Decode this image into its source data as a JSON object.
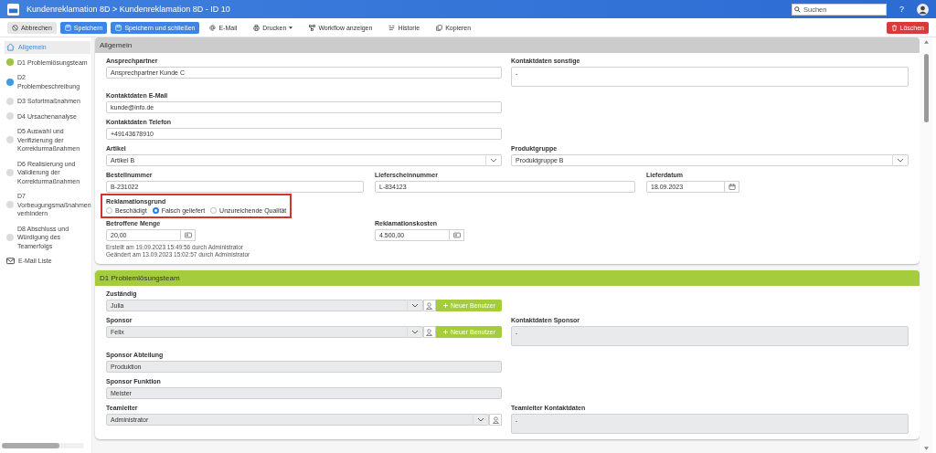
{
  "header": {
    "title": "Kundenreklamation 8D > Kundenreklamation 8D - ID 10",
    "search": {
      "placeholder": "Suchen"
    },
    "help": "?"
  },
  "toolbar": [
    {
      "label": "Abbrechen",
      "kind": "cancel"
    },
    {
      "label": "Speichern",
      "kind": "save"
    },
    {
      "label": "Speichern und schließen",
      "kind": "save"
    },
    {
      "label": "E-Mail",
      "kind": "email"
    },
    {
      "label": "Drucken",
      "kind": "print"
    },
    {
      "label": "Workflow anzeigen",
      "kind": "workflow"
    },
    {
      "label": "Historie",
      "kind": "history"
    },
    {
      "label": "Kopieren",
      "kind": "copy"
    },
    {
      "label": "Löschen",
      "kind": "delete"
    }
  ],
  "sidebar": {
    "items": [
      {
        "label": "Allgemein",
        "kind": "home",
        "selected": true
      },
      {
        "label": "D1 Problemlösungsteam",
        "kind": "step",
        "color": "#9bc53d",
        "selected": false
      },
      {
        "label": "D2 Problembeschreibung",
        "kind": "step",
        "color": "#3d9be9",
        "selected": false
      },
      {
        "label": "D3 Sofortmaßnahmen",
        "kind": "step",
        "color": "#dcdcdc",
        "selected": false
      },
      {
        "label": "D4 Ursachenanalyse",
        "kind": "step",
        "color": "#dcdcdc",
        "selected": false
      },
      {
        "label": "D5 Auswahl und Verifizierung der Korrekturmaßnahmen",
        "kind": "step",
        "color": "#dcdcdc",
        "selected": false
      },
      {
        "label": "D6 Realisierung und Validierung der Korrekturmaßnahmen",
        "kind": "step",
        "color": "#dcdcdc",
        "selected": false
      },
      {
        "label": "D7 Vorbeugungsmaßnahmen verhindern",
        "kind": "step",
        "color": "#dcdcdc",
        "selected": false
      },
      {
        "label": "D8 Abschluss und Würdigung des Teamerfolgs",
        "kind": "step",
        "color": "#dcdcdc",
        "selected": false
      },
      {
        "label": "E-Mail Liste",
        "kind": "mail",
        "selected": false
      }
    ]
  },
  "sections": [
    {
      "title": "Allgemein",
      "color": "#cccccc",
      "rows": [
        {
          "kind": "pair",
          "fields": [
            {
              "label": "Ansprechpartner",
              "kind": "text",
              "value": "Ansprechpartner Kunde C",
              "disabled": false
            },
            {
              "label": "Kontaktdaten sonstige",
              "kind": "textarea",
              "value": "-",
              "disabled": false
            }
          ]
        },
        {
          "kind": "pair",
          "fields": [
            {
              "label": "Kontaktdaten E-Mail",
              "kind": "text",
              "value": "kunde@info.de",
              "disabled": false
            }
          ]
        },
        {
          "kind": "pair",
          "fields": [
            {
              "label": "Kontaktdaten Telefon",
              "kind": "text",
              "value": "+49143678910",
              "disabled": false
            }
          ]
        },
        {
          "kind": "pair",
          "fields": [
            {
              "label": "Artikel",
              "kind": "select",
              "value": "Artikel B",
              "disabled": false
            },
            {
              "label": "Produktgruppe",
              "kind": "select",
              "value": "Produktgruppe B",
              "disabled": false
            }
          ]
        },
        {
          "kind": "triple",
          "fields": [
            {
              "label": "Bestellnummer",
              "kind": "text",
              "value": "B-231022",
              "disabled": false
            },
            {
              "label": "Lieferscheinnummer",
              "kind": "text",
              "value": "L-834123",
              "disabled": false
            },
            {
              "label": "Lieferdatum",
              "kind": "date",
              "value": "18.09.2023",
              "disabled": false
            }
          ]
        },
        {
          "kind": "pair",
          "fields": [
            {
              "label": "Reklamationsgrund",
              "kind": "radio",
              "highlighted": true,
              "options": [
                {
                  "label": "Beschädigt",
                  "selected": false
                },
                {
                  "label": "Falsch geliefert",
                  "selected": true
                },
                {
                  "label": "Unzureichende Qualität",
                  "selected": false
                }
              ]
            }
          ]
        },
        {
          "kind": "triple",
          "fields": [
            {
              "label": "Betroffene Menge",
              "kind": "number",
              "value": "20,00",
              "disabled": false
            },
            {
              "label": "Reklamationskosten",
              "kind": "number",
              "value": "4.500,00",
              "disabled": false
            }
          ]
        }
      ],
      "meta": [
        "Erstellt am 19.09.2023 15:49:56 durch Administrator",
        "Geändert am 13.09.2023 15:02:57 durch Administrator"
      ]
    },
    {
      "title": "D1 Problemlösungsteam",
      "color": "#a4cc3c",
      "rows": [
        {
          "kind": "pair",
          "fields": [
            {
              "label": "Zuständig",
              "kind": "user",
              "value": "Julia",
              "button": "Neuer Benutzer",
              "disabled": true
            }
          ]
        },
        {
          "kind": "pair",
          "fields": [
            {
              "label": "Sponsor",
              "kind": "user",
              "value": "Felix",
              "button": "Neuer Benutzer",
              "disabled": true
            },
            {
              "label": "Kontaktdaten Sponsor",
              "kind": "textarea",
              "value": "-",
              "disabled": true
            }
          ]
        },
        {
          "kind": "pair",
          "fields": [
            {
              "label": "Sponsor Abteilung",
              "kind": "text",
              "value": "Produktion",
              "disabled": true
            }
          ]
        },
        {
          "kind": "pair",
          "fields": [
            {
              "label": "Sponsor Funktion",
              "kind": "text",
              "value": "Meister",
              "disabled": true
            }
          ]
        },
        {
          "kind": "pair",
          "fields": [
            {
              "label": "Teamleiter",
              "kind": "user",
              "value": "Administrator",
              "disabled": true
            },
            {
              "label": "Teamleiter Kontaktdaten",
              "kind": "textarea",
              "value": "-",
              "disabled": true
            }
          ]
        }
      ]
    }
  ]
}
